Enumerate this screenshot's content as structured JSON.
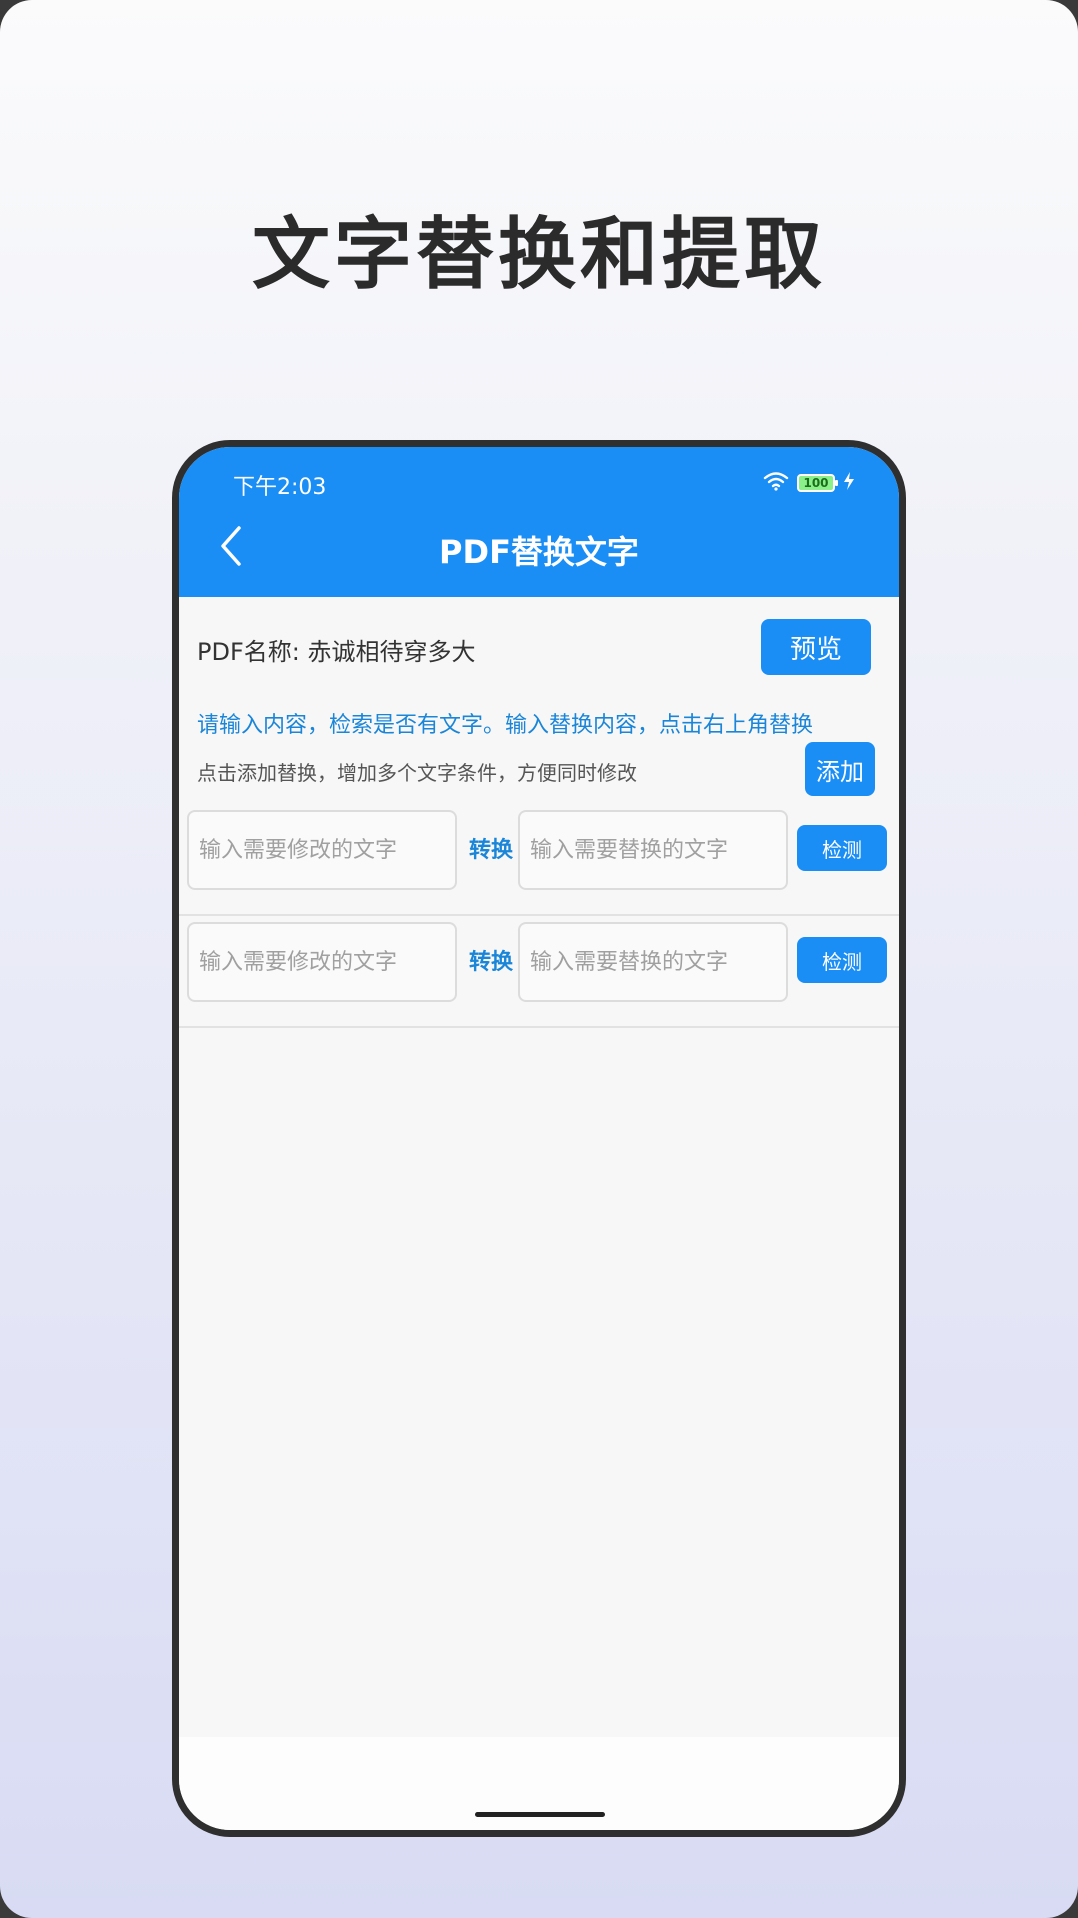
{
  "headline": "文字替换和提取",
  "status_bar": {
    "time": "下午2:03",
    "battery": "100"
  },
  "app_bar": {
    "title": "PDF替换文字"
  },
  "pdf": {
    "name_label": "PDF名称: 赤诚相待穿多大",
    "preview_label": "预览"
  },
  "hints": {
    "blue": "请输入内容，检索是否有文字。输入替换内容，点击右上角替换",
    "gray": "点击添加替换，增加多个文字条件，方便同时修改",
    "add_label": "添加"
  },
  "rows": [
    {
      "source_placeholder": "输入需要修改的文字",
      "convert_label": "转换",
      "target_placeholder": "输入需要替换的文字",
      "check_label": "检测"
    },
    {
      "source_placeholder": "输入需要修改的文字",
      "convert_label": "转换",
      "target_placeholder": "输入需要替换的文字",
      "check_label": "检测"
    }
  ],
  "colors": {
    "accent": "#1b8ef6",
    "hint_blue": "#1b86d8"
  },
  "icons": [
    "back-arrow-icon",
    "wifi-icon",
    "battery-icon",
    "charging-icon"
  ]
}
